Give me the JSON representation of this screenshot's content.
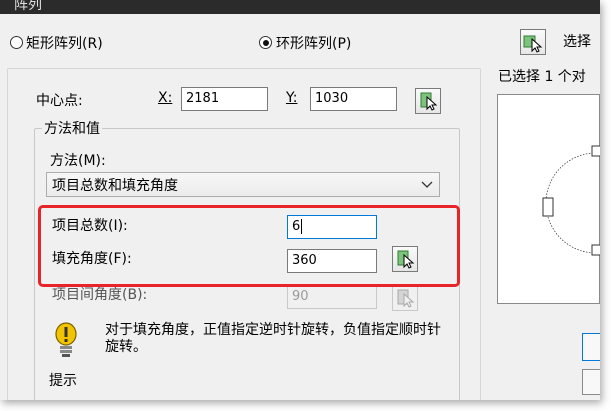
{
  "window": {
    "title": "阵列"
  },
  "array_type": {
    "rect_label": "矩形阵列(R)",
    "polar_label": "环形阵列(P)",
    "selected": "polar"
  },
  "select_objects": {
    "button_label": "选择",
    "selected_status": "已选择 1 个对"
  },
  "center_point": {
    "label": "中心点:",
    "x_label": "X:",
    "x_value": "2181",
    "y_label": "Y:",
    "y_value": "1030"
  },
  "method_group": {
    "title": "方法和值",
    "method_label": "方法(M):",
    "method_value": "项目总数和填充角度",
    "total_items_label": "项目总数(I):",
    "total_items_value": "6",
    "fill_angle_label": "填充角度(F):",
    "fill_angle_value": "360",
    "angle_between_label": "项目间角度(B):",
    "angle_between_value": "90"
  },
  "hint": {
    "text": "对于填充角度，正值指定逆时针旋转，负值指定顺时针旋转。",
    "label": "提示"
  },
  "colors": {
    "highlight": "#e8232a",
    "focus_border": "#0078d7",
    "hint_bulb": "#f2c300"
  },
  "icons": {
    "pick": "cursor-pick-icon",
    "hint": "lightbulb-icon"
  }
}
